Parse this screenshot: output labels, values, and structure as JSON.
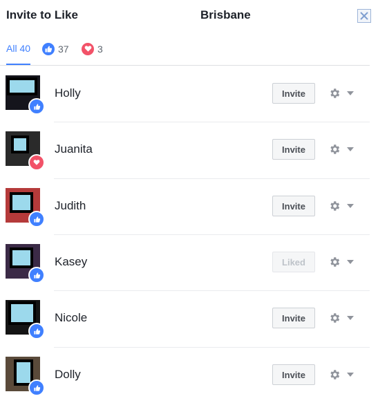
{
  "header": {
    "title": "Invite to Like",
    "page_name": "Brisbane"
  },
  "tabs": [
    {
      "label": "All 40",
      "active": true
    },
    {
      "icon": "thumbs-up-icon",
      "count": "37"
    },
    {
      "icon": "heart-icon",
      "count": "3"
    }
  ],
  "colors": {
    "accent": "#4080ff",
    "like": "#4080ff",
    "love": "#f25268"
  },
  "people": [
    {
      "name": "Holly",
      "reaction": "like",
      "button": "Invite",
      "button_enabled": true
    },
    {
      "name": "Juanita",
      "reaction": "love",
      "button": "Invite",
      "button_enabled": true
    },
    {
      "name": "Judith",
      "reaction": "like",
      "button": "Invite",
      "button_enabled": true
    },
    {
      "name": "Kasey",
      "reaction": "like",
      "button": "Liked",
      "button_enabled": false
    },
    {
      "name": "Nicole",
      "reaction": "like",
      "button": "Invite",
      "button_enabled": true
    },
    {
      "name": "Dolly",
      "reaction": "like",
      "button": "Invite",
      "button_enabled": true
    }
  ]
}
